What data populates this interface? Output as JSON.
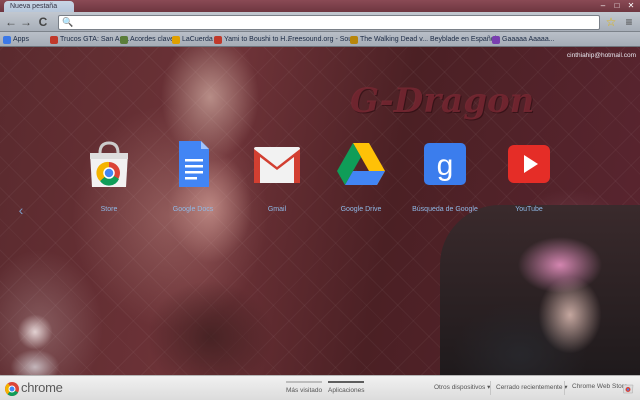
{
  "window": {
    "tab_title": "Nueva pestaña",
    "minimize": "–",
    "maximize": "□",
    "close": "✕"
  },
  "toolbar": {
    "back_icon": "back-arrow-icon",
    "forward_icon": "forward-arrow-icon",
    "reload_icon": "reload-icon",
    "back_glyph": "←",
    "forward_glyph": "→",
    "reload_glyph": "C",
    "search_glyph": "🔍",
    "omnibox_value": "",
    "star_glyph": "☆",
    "menu_glyph": "≡"
  },
  "bookmarks": [
    {
      "label": "Apps",
      "color": "#3b78e7"
    },
    {
      "label": "Trucos GTA: San An...",
      "color": "#c0392b"
    },
    {
      "label": "Acordes clave",
      "color": "#5b7d3a"
    },
    {
      "label": "LaCuerda",
      "color": "#e0a000"
    },
    {
      "label": "Yami to Boushi to H...",
      "color": "#c0392b"
    },
    {
      "label": "Freesound.org - Sou...",
      "color": "#2a6fb0"
    },
    {
      "label": "The Walking Dead v...",
      "color": "#b8860b"
    },
    {
      "label": "Beyblade en Español",
      "color": "#1e5aa8"
    },
    {
      "label": "Gaaaaa Aaaaa...",
      "color": "#7a3fb0"
    }
  ],
  "theme": {
    "brand_text": "G-Dragon",
    "account": "cinthiahip@hotmail.com",
    "pager_left": "‹"
  },
  "apps": [
    {
      "label": "Store"
    },
    {
      "label": "Google Docs"
    },
    {
      "label": "Gmail"
    },
    {
      "label": "Google Drive"
    },
    {
      "label": "Búsqueda de Google"
    },
    {
      "label": "YouTube"
    }
  ],
  "bottombar": {
    "brand": "chrome",
    "tab_most_visited": "Más visitado",
    "tab_apps": "Aplicaciones",
    "other_devices": "Otros dispositivos",
    "recently_closed": "Cerrado recientemente",
    "web_store": "Chrome Web Store",
    "dropdown_glyph": "▾"
  }
}
